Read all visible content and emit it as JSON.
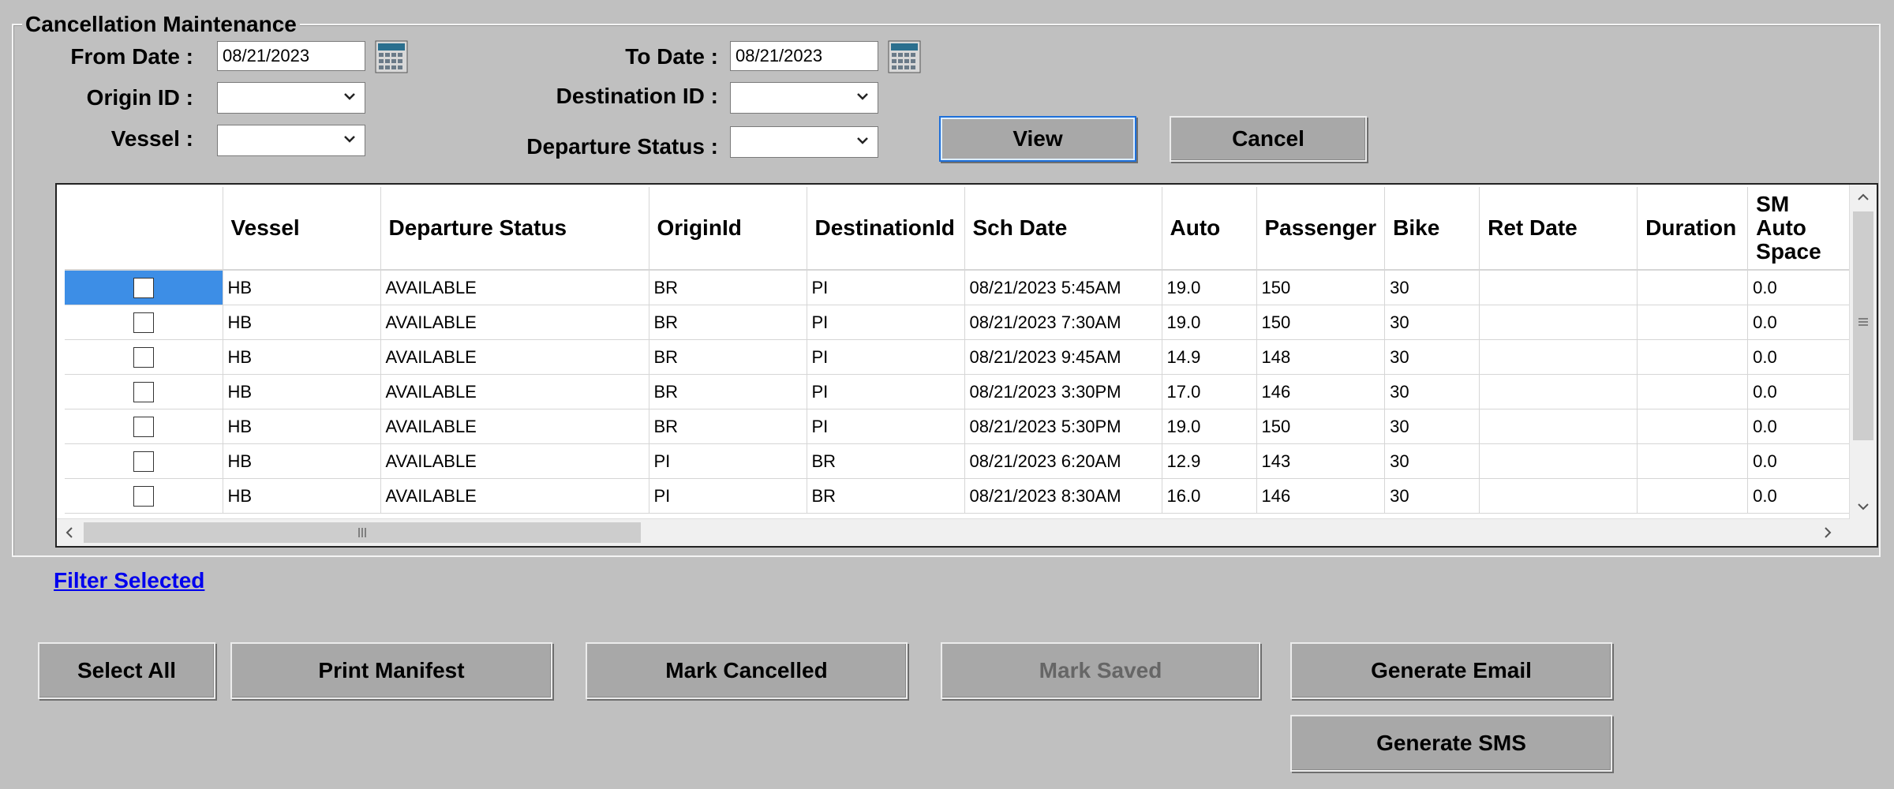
{
  "form": {
    "title": "Cancellation Maintenance",
    "from_date_label": "From Date :",
    "from_date_value": "08/21/2023",
    "to_date_label": "To Date :",
    "to_date_value": "08/21/2023",
    "origin_label": "Origin ID :",
    "origin_value": "",
    "destination_label": "Destination ID :",
    "destination_value": "",
    "vessel_label": "Vessel :",
    "vessel_value": "",
    "departure_status_label": "Departure Status :",
    "departure_status_value": "",
    "view_label": "View",
    "cancel_label": "Cancel"
  },
  "grid": {
    "columns": [
      "",
      "Vessel",
      "Departure Status",
      "OriginId",
      "DestinationId",
      "Sch Date",
      "Auto",
      "Passenger",
      "Bike",
      "Ret Date",
      "Duration",
      "SM Auto Space"
    ],
    "rows": [
      [
        "HB",
        "AVAILABLE",
        "BR",
        "PI",
        "08/21/2023  5:45AM",
        "19.0",
        "150",
        "30",
        "",
        "",
        "0.0"
      ],
      [
        "HB",
        "AVAILABLE",
        "BR",
        "PI",
        "08/21/2023  7:30AM",
        "19.0",
        "150",
        "30",
        "",
        "",
        "0.0"
      ],
      [
        "HB",
        "AVAILABLE",
        "BR",
        "PI",
        "08/21/2023  9:45AM",
        "14.9",
        "148",
        "30",
        "",
        "",
        "0.0"
      ],
      [
        "HB",
        "AVAILABLE",
        "BR",
        "PI",
        "08/21/2023  3:30PM",
        "17.0",
        "146",
        "30",
        "",
        "",
        "0.0"
      ],
      [
        "HB",
        "AVAILABLE",
        "BR",
        "PI",
        "08/21/2023  5:30PM",
        "19.0",
        "150",
        "30",
        "",
        "",
        "0.0"
      ],
      [
        "HB",
        "AVAILABLE",
        "PI",
        "BR",
        "08/21/2023  6:20AM",
        "12.9",
        "143",
        "30",
        "",
        "",
        "0.0"
      ],
      [
        "HB",
        "AVAILABLE",
        "PI",
        "BR",
        "08/21/2023  8:30AM",
        "16.0",
        "146",
        "30",
        "",
        "",
        "0.0"
      ]
    ]
  },
  "filter_link": "Filter Selected",
  "actions": {
    "select_all": "Select All",
    "print_manifest": "Print Manifest",
    "mark_cancelled": "Mark Cancelled",
    "mark_saved": "Mark Saved",
    "generate_email": "Generate Email",
    "generate_sms": "Generate SMS"
  }
}
